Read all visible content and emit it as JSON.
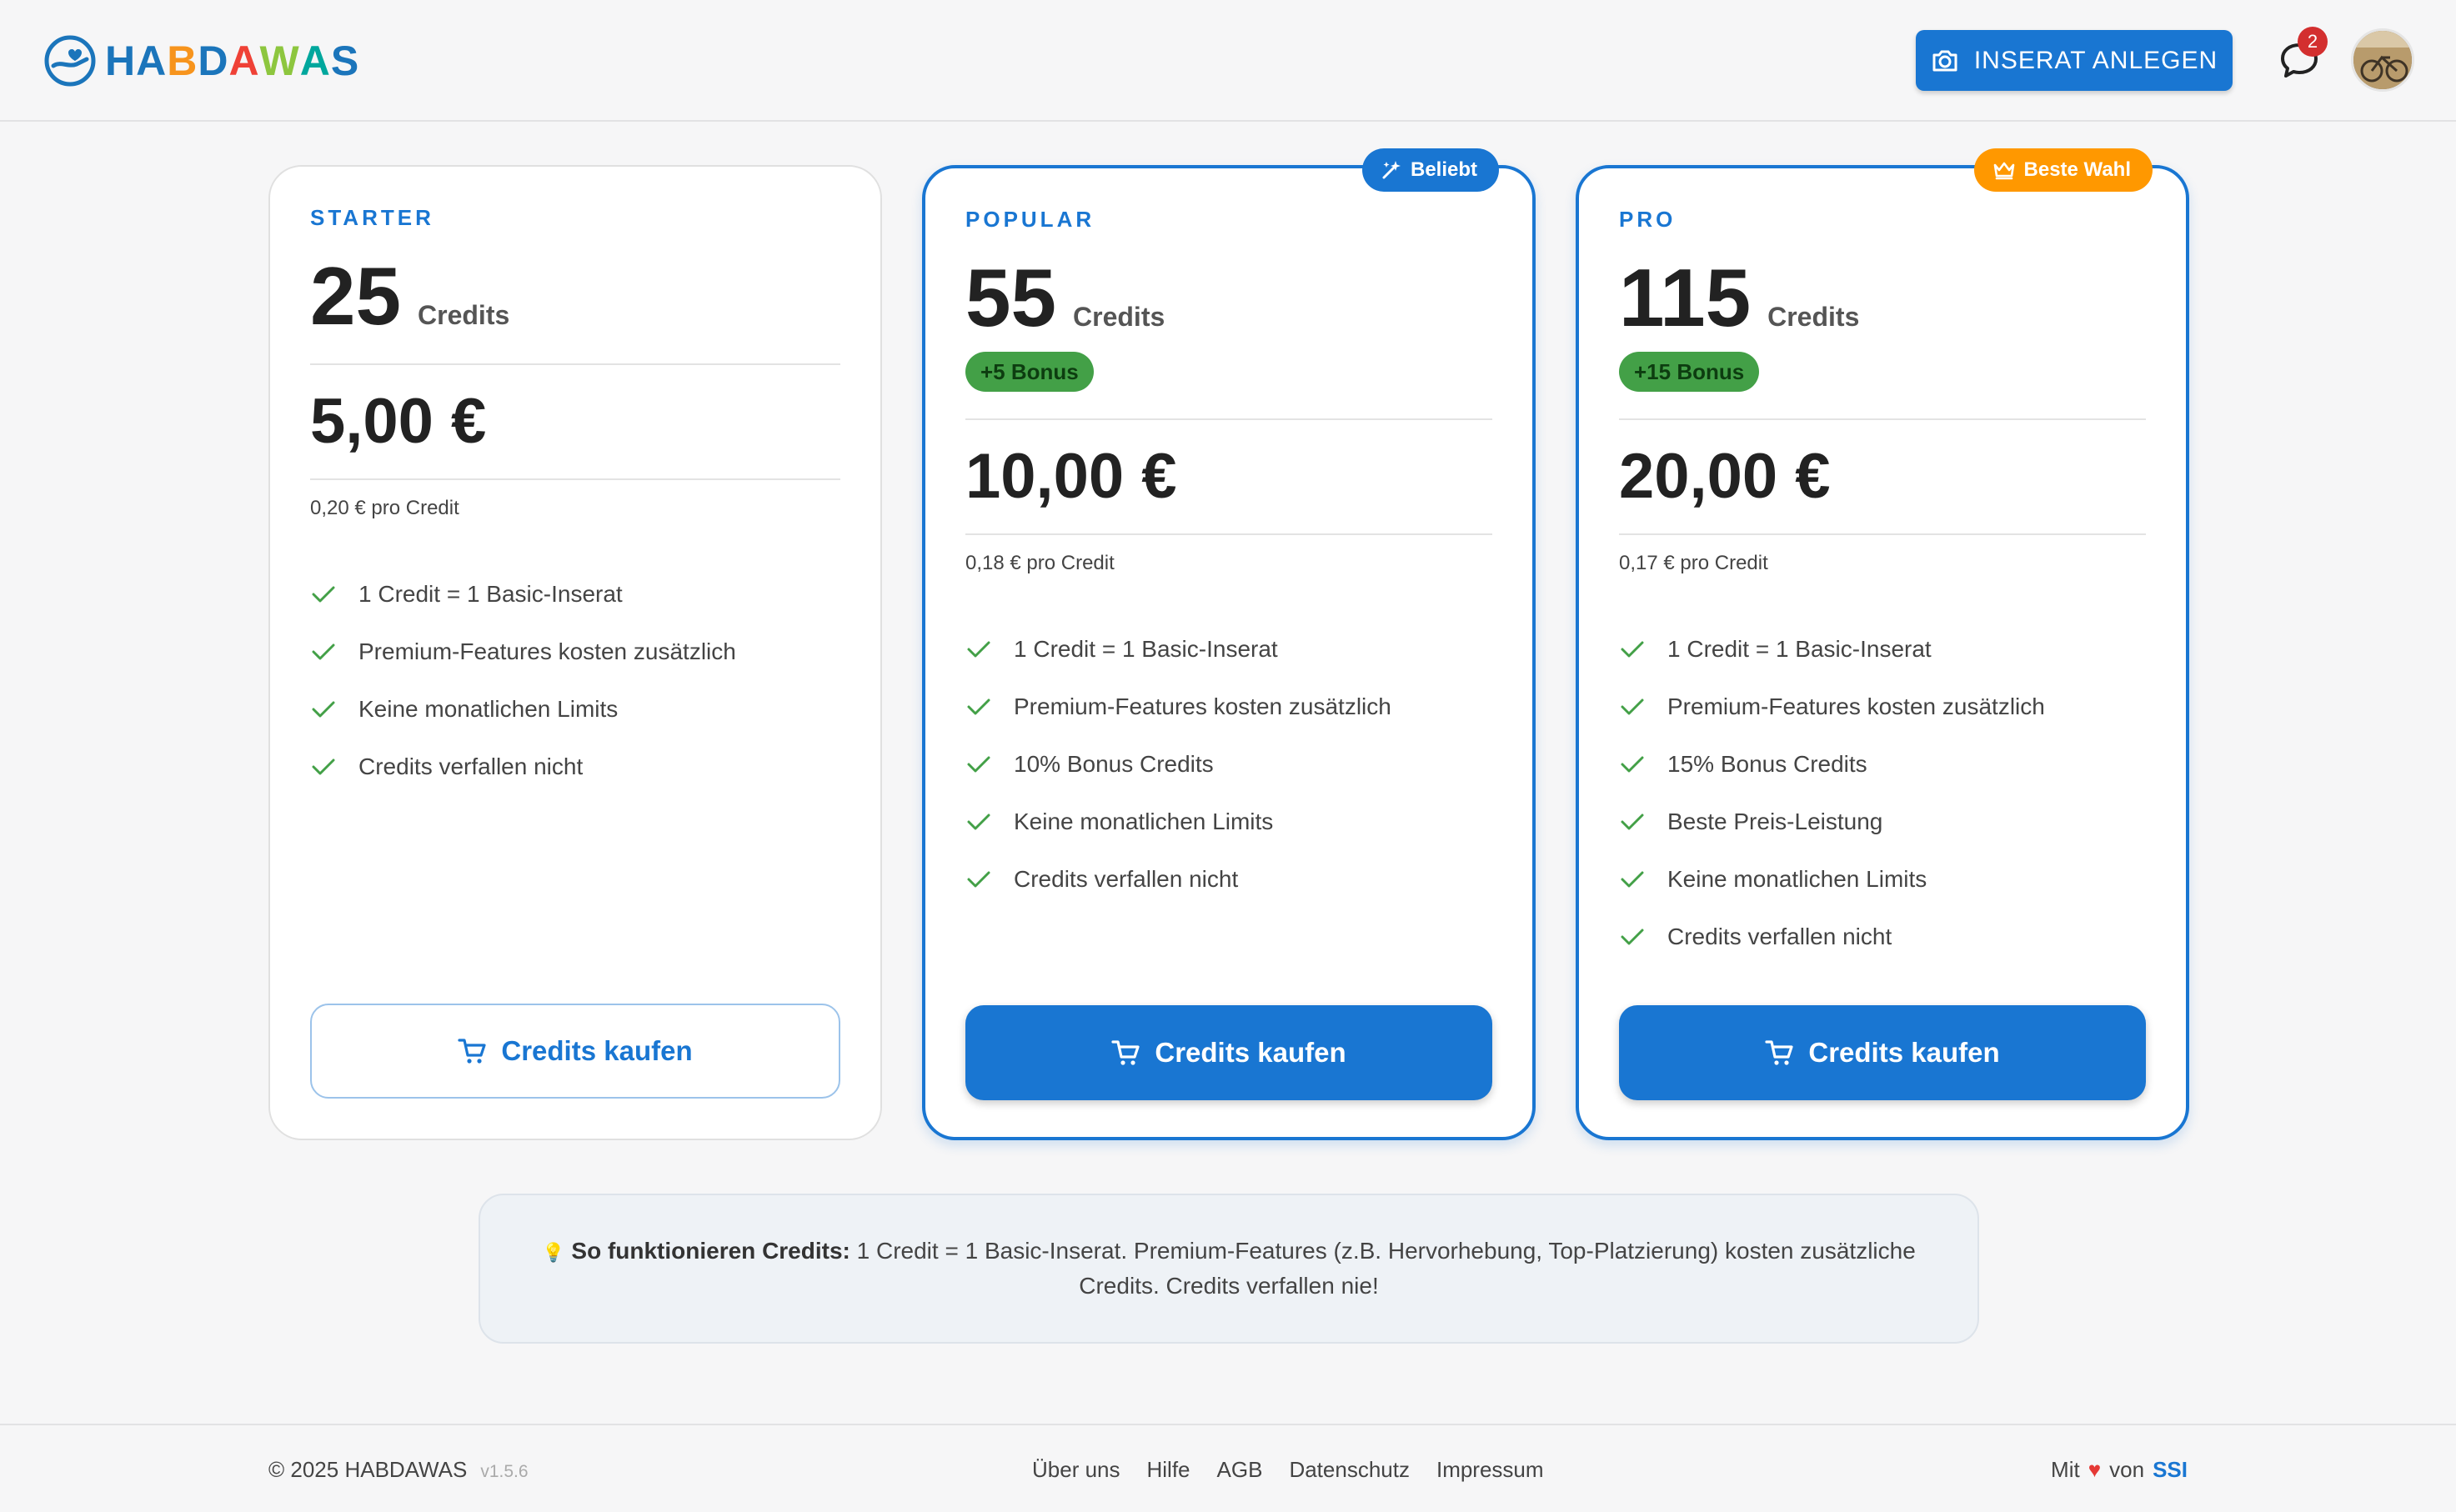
{
  "header": {
    "logo_letters": [
      {
        "char": "H",
        "color": "#1b75bb"
      },
      {
        "char": "A",
        "color": "#1b75bb"
      },
      {
        "char": "B",
        "color": "#f7941d"
      },
      {
        "char": "D",
        "color": "#1b75bb"
      },
      {
        "char": "A",
        "color": "#ef4136"
      },
      {
        "char": "W",
        "color": "#8dc63f"
      },
      {
        "char": "A",
        "color": "#00a79d"
      },
      {
        "char": "S",
        "color": "#1b75bb"
      }
    ],
    "logo_icon": "hand-heart-icon",
    "create_listing_label": "INSERAT ANLEGEN",
    "create_listing_icon": "camera-icon",
    "chat_icon": "chat-bubble-icon",
    "notification_count": "2",
    "avatar_icon": "user-avatar"
  },
  "plans": [
    {
      "name": "STARTER",
      "credits": "25",
      "credits_unit": "Credits",
      "price": "5,00 €",
      "per_credit": "0,20 € pro Credit",
      "features": [
        "1 Credit = 1 Basic-Inserat",
        "Premium-Features kosten zusätzlich",
        "Keine monatlichen Limits",
        "Credits verfallen nicht"
      ],
      "button_label": "Credits kaufen"
    },
    {
      "name": "POPULAR",
      "tag": "Beliebt",
      "tag_icon": "sparkle-icon",
      "credits": "55",
      "credits_unit": "Credits",
      "bonus": "+5 Bonus",
      "price": "10,00 €",
      "per_credit": "0,18 € pro Credit",
      "features": [
        "1 Credit = 1 Basic-Inserat",
        "Premium-Features kosten zusätzlich",
        "10% Bonus Credits",
        "Keine monatlichen Limits",
        "Credits verfallen nicht"
      ],
      "button_label": "Credits kaufen"
    },
    {
      "name": "PRO",
      "tag": "Beste Wahl",
      "tag_icon": "crown-icon",
      "credits": "115",
      "credits_unit": "Credits",
      "bonus": "+15 Bonus",
      "price": "20,00 €",
      "per_credit": "0,17 € pro Credit",
      "features": [
        "1 Credit = 1 Basic-Inserat",
        "Premium-Features kosten zusätzlich",
        "15% Bonus Credits",
        "Beste Preis-Leistung",
        "Keine monatlichen Limits",
        "Credits verfallen nicht"
      ],
      "button_label": "Credits kaufen"
    }
  ],
  "info": {
    "icon": "💡",
    "title": "So funktionieren Credits:",
    "text": " 1 Credit = 1 Basic-Inserat. Premium-Features (z.B. Hervorhebung, Top-Platzierung) kosten zusätzliche Credits. Credits verfallen nie!"
  },
  "footer": {
    "copyright": "© 2025 HABDAWAS",
    "version": "v1.5.6",
    "links": [
      "Über uns",
      "Hilfe",
      "AGB",
      "Datenschutz",
      "Impressum"
    ],
    "made_with_prefix": "Mit",
    "heart": "♥",
    "made_with_by": "von",
    "made_by": "SSI"
  },
  "colors": {
    "accent": "#1976d2",
    "bonus_green": "#43a047",
    "orange": "#ff9800",
    "check_green": "#43a047"
  }
}
